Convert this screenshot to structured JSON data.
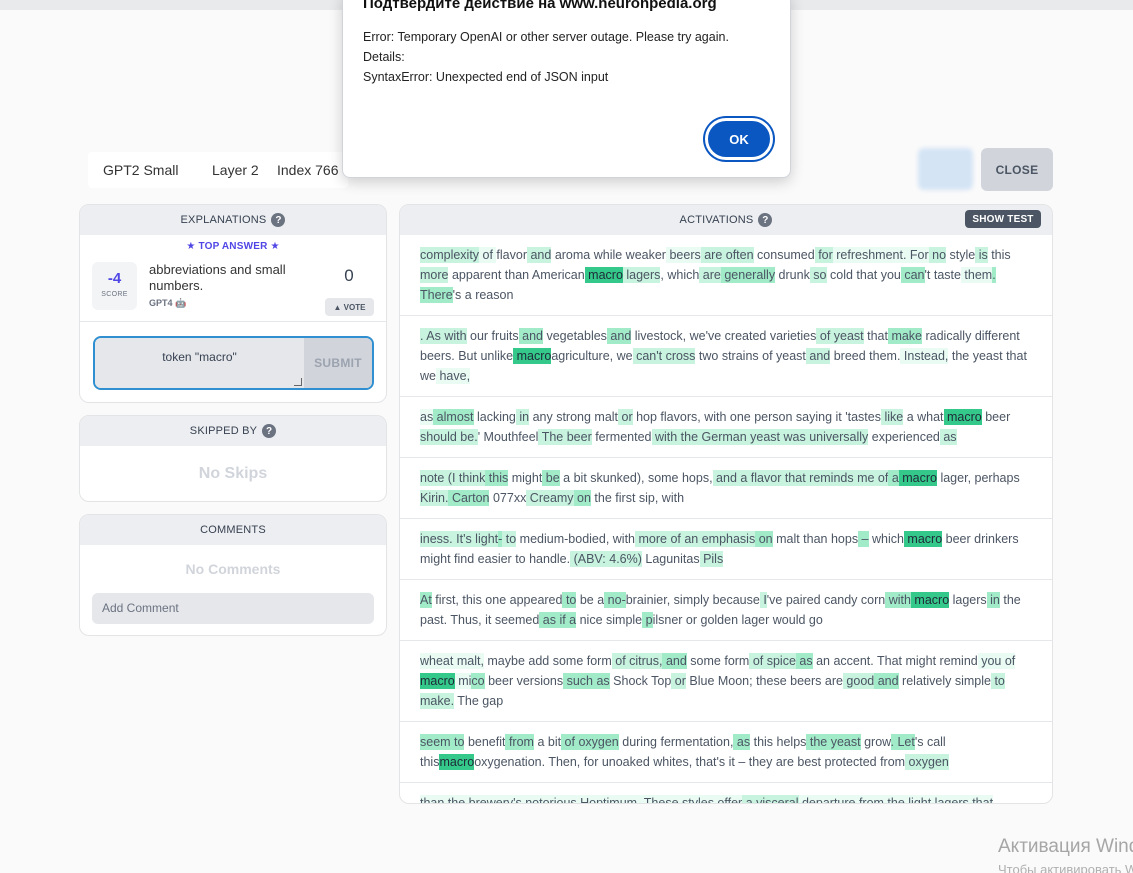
{
  "header": {
    "model": "GPT2 Small",
    "layer": "Layer 2",
    "index": "Index 766",
    "close_label": "CLOSE"
  },
  "explanations": {
    "title": "EXPLANATIONS",
    "top_answer": "★ TOP ANSWER ★",
    "score": "-4",
    "score_label": "SCORE",
    "text": "abbreviations and small numbers.",
    "author": "GPT4",
    "votes": "0",
    "vote_label": "▲ VOTE",
    "test_input": "token \"macro\"",
    "submit_label": "SUBMIT"
  },
  "skipped": {
    "title": "SKIPPED BY",
    "empty": "No Skips"
  },
  "comments": {
    "title": "COMMENTS",
    "empty": "No Comments",
    "placeholder": "Add Comment"
  },
  "activations": {
    "title": "ACTIVATIONS",
    "show_test": "SHOW TEST",
    "items": [
      [
        [
          "complexity",
          "h2"
        ],
        [
          " of ",
          "h1"
        ],
        [
          "flavor",
          ""
        ],
        [
          " and",
          "h2"
        ],
        [
          " aroma while weaker",
          ""
        ],
        [
          " beers",
          "h1"
        ],
        [
          " are",
          "h2"
        ],
        [
          " often",
          "h2"
        ],
        [
          " consumed",
          ""
        ],
        [
          " for",
          "h2"
        ],
        [
          " refreshment. For",
          "h1"
        ],
        [
          " no",
          "h2"
        ],
        [
          " style",
          ""
        ],
        [
          " is",
          "h2"
        ],
        [
          " this",
          ""
        ],
        [
          " more",
          "h2"
        ],
        [
          " apparent than American",
          ""
        ],
        [
          " macro",
          "hx"
        ],
        [
          " lagers",
          "h2"
        ],
        [
          ", which",
          ""
        ],
        [
          " are",
          "h2"
        ],
        [
          " generally",
          "h3"
        ],
        [
          " drunk",
          ""
        ],
        [
          " so",
          "h2"
        ],
        [
          " cold that you",
          ""
        ],
        [
          " can",
          "h3"
        ],
        [
          "'t taste",
          ""
        ],
        [
          " them",
          "h1"
        ],
        [
          ". There",
          "h3"
        ],
        [
          "'s",
          ""
        ],
        [
          " a reason",
          ""
        ]
      ],
      [
        [
          ". As with",
          "h2"
        ],
        [
          " our fruits",
          ""
        ],
        [
          " and",
          "h3"
        ],
        [
          " vegetables",
          ""
        ],
        [
          " and",
          "h3"
        ],
        [
          " livestock, we've created varieties",
          ""
        ],
        [
          " of yeast",
          "h2"
        ],
        [
          " that",
          ""
        ],
        [
          " make",
          "h3"
        ],
        [
          " radically",
          ""
        ],
        [
          " different beers. But unlike",
          ""
        ],
        [
          " macro",
          "hx"
        ],
        [
          "agriculture, we",
          ""
        ],
        [
          " can't cross",
          "h2"
        ],
        [
          " two strains of yeast",
          ""
        ],
        [
          " and",
          "h2"
        ],
        [
          " breed them.",
          ""
        ],
        [
          " Instead,",
          "h1"
        ],
        [
          " the yeast that we",
          ""
        ],
        [
          " have,",
          "h1"
        ]
      ],
      [
        [
          " as",
          "h1"
        ],
        [
          " almost",
          "h3"
        ],
        [
          " lacking",
          ""
        ],
        [
          " in",
          "h2"
        ],
        [
          " any strong malt",
          ""
        ],
        [
          " or",
          "h2"
        ],
        [
          " hop flavors, with one person saying it 'tastes",
          ""
        ],
        [
          " like",
          "h2"
        ],
        [
          " a what",
          ""
        ],
        [
          " macro",
          "hx"
        ],
        [
          " beer",
          ""
        ],
        [
          " should be.",
          "h2"
        ],
        [
          "' Mouthfeel",
          ""
        ],
        [
          " The beer",
          "h2"
        ],
        [
          " fermented",
          ""
        ],
        [
          " with the German yeast was universally",
          "h2"
        ],
        [
          " experienced",
          ""
        ],
        [
          " as",
          "h2"
        ]
      ],
      [
        [
          " note (I think",
          "h2"
        ],
        [
          " this",
          "h3"
        ],
        [
          " might",
          ""
        ],
        [
          " be",
          "h3"
        ],
        [
          " a bit skunked), some hops,",
          ""
        ],
        [
          " and a flavor that reminds me of",
          "h2"
        ],
        [
          " a",
          "h3"
        ],
        [
          " macro",
          "hx"
        ],
        [
          " lager,",
          ""
        ],
        [
          " perhaps",
          ""
        ],
        [
          " Kirin.",
          "h2"
        ],
        [
          " Carton",
          "h3"
        ],
        [
          " 077xx",
          ""
        ],
        [
          " Creamy",
          "h2"
        ],
        [
          " on",
          "h3"
        ],
        [
          " the first sip, with",
          ""
        ]
      ],
      [
        [
          "iness. It's light",
          "h2"
        ],
        [
          "-",
          "h3"
        ],
        [
          " to",
          "h2"
        ],
        [
          " medium-bodied, with",
          ""
        ],
        [
          " more of an emphasis",
          "h2"
        ],
        [
          " on",
          "h3"
        ],
        [
          " malt than hops",
          ""
        ],
        [
          " –",
          "h3"
        ],
        [
          " which",
          ""
        ],
        [
          " macro",
          "hx"
        ],
        [
          " beer",
          ""
        ],
        [
          " drinkers",
          ""
        ],
        [
          " might find easier",
          ""
        ],
        [
          " to",
          ""
        ],
        [
          " handle.",
          ""
        ],
        [
          " (ABV: 4.6%)",
          "h2"
        ],
        [
          " Lagunitas",
          ""
        ],
        [
          " Pils",
          "h2"
        ]
      ],
      [
        [
          "At",
          "h3"
        ],
        [
          " first,",
          ""
        ],
        [
          " this one appeared",
          ""
        ],
        [
          " to",
          "h3"
        ],
        [
          " be a",
          ""
        ],
        [
          " no-",
          "h3"
        ],
        [
          "brainier, simply because",
          ""
        ],
        [
          " I",
          "h2"
        ],
        [
          "'ve paired candy corn",
          ""
        ],
        [
          " with",
          "h3"
        ],
        [
          " macro",
          "hx"
        ],
        [
          " lagers",
          ""
        ],
        [
          " in",
          "h3"
        ],
        [
          " the past.",
          ""
        ],
        [
          " Thus, it seemed",
          ""
        ],
        [
          " as if a",
          "h3"
        ],
        [
          " nice simple",
          ""
        ],
        [
          " p",
          "h3"
        ],
        [
          "ilsner or golden lager would",
          ""
        ],
        [
          " go",
          ""
        ]
      ],
      [
        [
          " wheat malt,",
          "h1"
        ],
        [
          " maybe add some form",
          ""
        ],
        [
          " of citrus,",
          "h2"
        ],
        [
          " and",
          "h3"
        ],
        [
          " some form",
          ""
        ],
        [
          " of spice",
          "h2"
        ],
        [
          " as",
          "h3"
        ],
        [
          " an accent",
          ""
        ],
        [
          ". That",
          ""
        ],
        [
          " might remind",
          ""
        ],
        [
          " you of",
          "h1"
        ],
        [
          " macro",
          "hx"
        ],
        [
          " mi",
          "h1"
        ],
        [
          "co",
          "h3"
        ],
        [
          " beer versions",
          ""
        ],
        [
          " such as",
          "h3"
        ],
        [
          " Shock Top",
          ""
        ],
        [
          " or",
          "h2"
        ],
        [
          " Blue Moon; these beers are",
          ""
        ],
        [
          " good",
          "h2"
        ],
        [
          " and",
          "h3"
        ],
        [
          " relatively",
          ""
        ],
        [
          " simple",
          ""
        ],
        [
          " to make.",
          "h2"
        ],
        [
          " The gap",
          ""
        ]
      ],
      [
        [
          " seem to",
          "h3"
        ],
        [
          " benefit",
          ""
        ],
        [
          " from",
          "h3"
        ],
        [
          " a bit",
          ""
        ],
        [
          " of oxygen",
          "h3"
        ],
        [
          " during",
          ""
        ],
        [
          " fermentation,",
          ""
        ],
        [
          " as",
          "h3"
        ],
        [
          " this helps",
          ""
        ],
        [
          " the yeast",
          "h3"
        ],
        [
          " grow",
          ""
        ],
        [
          ". Let",
          "h3"
        ],
        [
          "'s call this",
          ""
        ],
        [
          "macro",
          "hx"
        ],
        [
          "oxygenation. Then,",
          ""
        ],
        [
          " for unoaked whites, that's it – they are best protected from",
          ""
        ],
        [
          " oxygen",
          "h2"
        ]
      ],
      [
        [
          "than the brewery's notorious Hoptimum. These styles offer",
          "h1"
        ],
        [
          " a visceral",
          "h2"
        ],
        [
          " departure from the light lagers that",
          "h1"
        ]
      ]
    ]
  },
  "modal": {
    "title": "Подтвердите действие на www.neuronpedia.org",
    "line1": "Error: Temporary OpenAI or other server outage. Please try again.",
    "line2": "Details:",
    "line3": "SyntaxError: Unexpected end of JSON input",
    "ok_label": "OK"
  },
  "windows_activation": {
    "line1": "Активация Windows",
    "line2": "Чтобы активировать Windows"
  }
}
